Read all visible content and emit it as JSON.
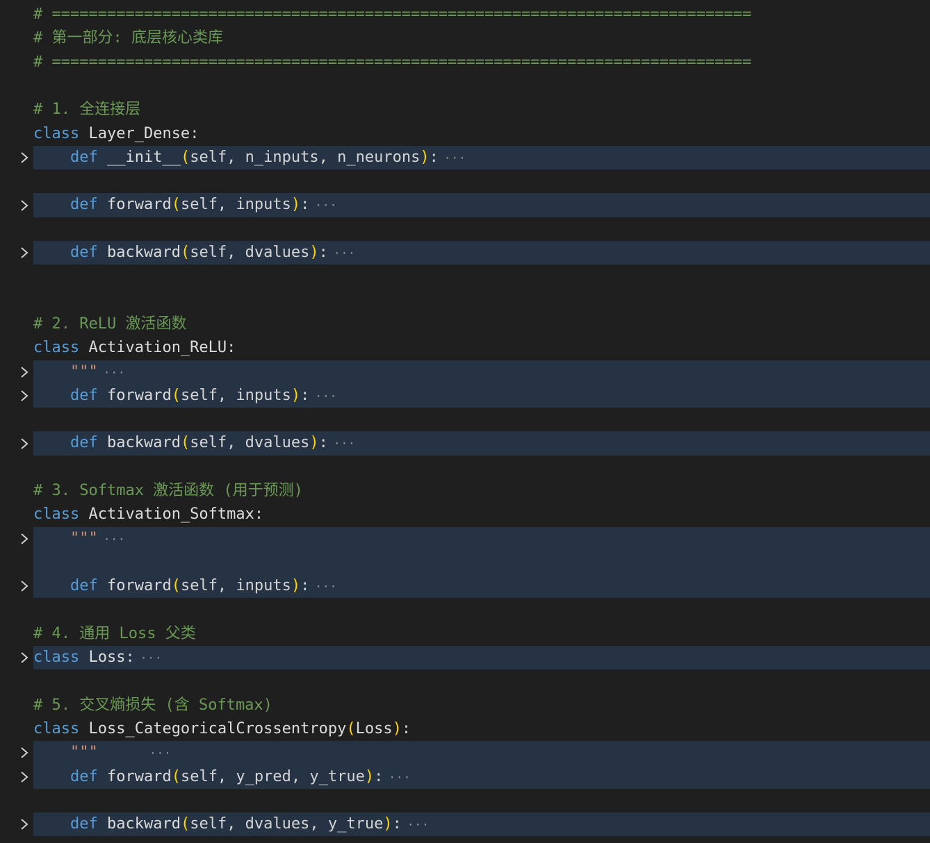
{
  "editor": {
    "language": "python",
    "colors": {
      "background": "#1f1f1f",
      "folded_highlight": "#253345",
      "comment": "#6a9955",
      "keyword": "#569cd6",
      "bracket": "#ffd700",
      "string": "#ce9178"
    },
    "lines": [
      {
        "kind": "comment",
        "text": "# ============================================================================"
      },
      {
        "kind": "comment",
        "text": "# 第一部分: 底层核心类库"
      },
      {
        "kind": "comment",
        "text": "# ============================================================================"
      },
      {
        "kind": "blank"
      },
      {
        "kind": "comment",
        "text": "# 1. 全连接层"
      },
      {
        "kind": "class",
        "name": "Layer_Dense",
        "base": ""
      },
      {
        "kind": "def",
        "folded": true,
        "name": "__init__",
        "params": "self, n_inputs, n_neurons"
      },
      {
        "kind": "blank"
      },
      {
        "kind": "def",
        "folded": true,
        "name": "forward",
        "params": "self, inputs"
      },
      {
        "kind": "blank"
      },
      {
        "kind": "def",
        "folded": true,
        "name": "backward",
        "params": "self, dvalues"
      },
      {
        "kind": "blank"
      },
      {
        "kind": "blank"
      },
      {
        "kind": "comment",
        "text": "# 2. ReLU 激活函数"
      },
      {
        "kind": "class",
        "name": "Activation_ReLU",
        "base": ""
      },
      {
        "kind": "docstring",
        "folded": true,
        "text": "\"\"\"",
        "gap": 0
      },
      {
        "kind": "def",
        "folded": true,
        "name": "forward",
        "params": "self, inputs"
      },
      {
        "kind": "blank"
      },
      {
        "kind": "def",
        "folded": true,
        "name": "backward",
        "params": "self, dvalues"
      },
      {
        "kind": "blank"
      },
      {
        "kind": "comment",
        "text": "# 3. Softmax 激活函数 (用于预测)"
      },
      {
        "kind": "class",
        "name": "Activation_Softmax",
        "base": ""
      },
      {
        "kind": "docstring",
        "folded": true,
        "text": "\"\"\"",
        "gap": 0
      },
      {
        "kind": "blank_highlight"
      },
      {
        "kind": "def",
        "folded": true,
        "name": "forward",
        "params": "self, inputs"
      },
      {
        "kind": "blank"
      },
      {
        "kind": "comment",
        "text": "# 4. 通用 Loss 父类"
      },
      {
        "kind": "class",
        "folded": true,
        "name": "Loss",
        "base": ""
      },
      {
        "kind": "blank"
      },
      {
        "kind": "comment",
        "text": "# 5. 交叉熵损失 (含 Softmax)"
      },
      {
        "kind": "class",
        "name": "Loss_CategoricalCrossentropy",
        "base": "Loss"
      },
      {
        "kind": "docstring",
        "folded": true,
        "text": "\"\"\"",
        "gap": 1
      },
      {
        "kind": "def",
        "folded": true,
        "name": "forward",
        "params": "self, y_pred, y_true"
      },
      {
        "kind": "blank"
      },
      {
        "kind": "def",
        "folded": true,
        "name": "backward",
        "params": "self, dvalues, y_true"
      }
    ],
    "ellipsis": "···",
    "keywords": {
      "class": "class",
      "def": "def"
    }
  }
}
